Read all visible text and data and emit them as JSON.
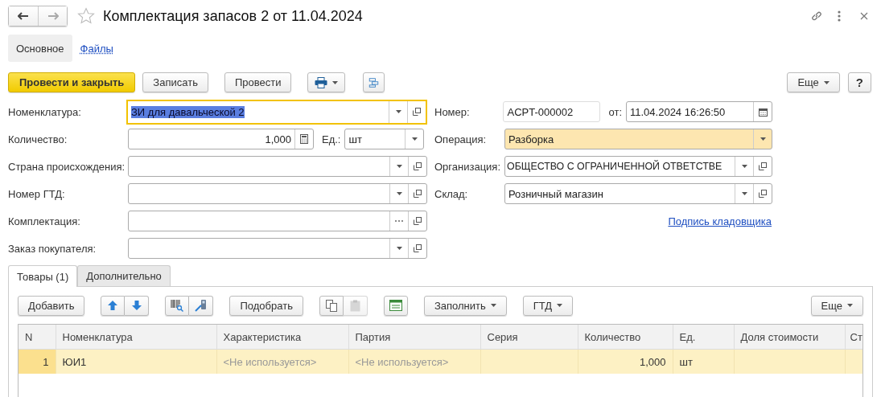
{
  "window": {
    "title": "Комплектация запасов 2 от 11.04.2024",
    "favorite": false
  },
  "sections": [
    {
      "label": "Основное",
      "selected": true
    },
    {
      "label": "Файлы",
      "selected": false
    }
  ],
  "command_bar": {
    "left": [
      {
        "kind": "primary",
        "label": "Провести и закрыть"
      },
      {
        "kind": "plain",
        "label": "Записать"
      },
      {
        "kind": "plain",
        "label": "Провести"
      },
      {
        "kind": "print"
      },
      {
        "kind": "structure"
      }
    ],
    "right": [
      {
        "kind": "menu",
        "label": "Еще"
      },
      {
        "kind": "plain",
        "label": "?"
      }
    ]
  },
  "form_left": [
    {
      "label": "Номенклатура:",
      "value": "ЗИ для давальческой 2",
      "kind": "text",
      "focused": true,
      "buttons": [
        {
          "kind": "dropdown"
        },
        {
          "kind": "open"
        }
      ]
    },
    {
      "label": "Количество:",
      "value": "1,000",
      "kind": "number",
      "focused": false,
      "buttons": [
        {
          "kind": "calculator"
        }
      ],
      "unit": {
        "label": "Ед.:",
        "value": "шт",
        "buttons": [
          {
            "kind": "dropdown"
          }
        ]
      }
    },
    {
      "label": "Страна происхождения:",
      "kind": "text",
      "focused": false,
      "buttons": [
        {
          "kind": "dropdown"
        },
        {
          "kind": "open"
        }
      ]
    },
    {
      "label": "Номер ГТД:",
      "kind": "text",
      "focused": false,
      "buttons": [
        {
          "kind": "dropdown"
        },
        {
          "kind": "open"
        }
      ]
    },
    {
      "label": "Комплектация:",
      "kind": "text",
      "focused": false,
      "buttons": [
        {
          "kind": "ellipsis"
        },
        {
          "kind": "open"
        }
      ]
    },
    {
      "label": "Заказ покупателя:",
      "kind": "text",
      "focused": false,
      "buttons": [
        {
          "kind": "dropdown"
        },
        {
          "kind": "open"
        }
      ]
    }
  ],
  "form_right": [
    {
      "label": "Номер:",
      "value": "ACPT-000002",
      "kind": "input",
      "highlighted": false,
      "date": {
        "label": "от:",
        "value": "11.04.2024 16:26:50",
        "buttons": [
          {
            "kind": "calendar"
          }
        ]
      }
    },
    {
      "label": "Операция:",
      "value": "Разборка",
      "kind": "select",
      "highlighted": true,
      "buttons": [
        {
          "kind": "dropdown"
        }
      ]
    },
    {
      "label": "Организация:",
      "value": "ОБЩЕСТВО С ОГРАНИЧЕННОЙ ОТВЕТСТВЕ",
      "kind": "select",
      "highlighted": false,
      "buttons": [
        {
          "kind": "dropdown"
        },
        {
          "kind": "open"
        }
      ]
    },
    {
      "label": "Склад:",
      "value": "Розничный магазин",
      "kind": "select",
      "highlighted": false,
      "buttons": [
        {
          "kind": "dropdown"
        },
        {
          "kind": "open"
        }
      ]
    }
  ],
  "signature_link": "Подпись кладовщика",
  "tabs": [
    {
      "label": "Товары (1)",
      "selected": true
    },
    {
      "label": "Дополнительно",
      "selected": false
    }
  ],
  "toolbar": {
    "left": [
      {
        "kind": "button",
        "label": "Добавить"
      },
      {
        "kind": "move"
      },
      {
        "kind": "scan"
      },
      {
        "kind": "button",
        "label": "Подобрать"
      },
      {
        "kind": "clipboard"
      },
      {
        "kind": "report"
      },
      {
        "kind": "menu",
        "label": "Заполнить"
      },
      {
        "kind": "menu",
        "label": "ГТД"
      }
    ],
    "right": [
      {
        "kind": "menu",
        "label": "Еще"
      }
    ]
  },
  "table": {
    "columns": [
      {
        "label": "N"
      },
      {
        "label": "Номенклатура"
      },
      {
        "label": "Характеристика"
      },
      {
        "label": "Партия"
      },
      {
        "label": "Серия"
      },
      {
        "label": "Количество"
      },
      {
        "label": "Ед."
      },
      {
        "label": "Доля стоимости"
      },
      {
        "label": "Ст"
      }
    ],
    "rows": [
      {
        "selected": true,
        "cells": [
          {
            "kind": "number",
            "text": "1"
          },
          {
            "kind": "text",
            "text": "ЮИ1"
          },
          {
            "kind": "placeholder",
            "text": "<Не используется>"
          },
          {
            "kind": "placeholder",
            "text": "<Не используется>"
          },
          {
            "kind": "empty"
          },
          {
            "kind": "number",
            "text": "1,000"
          },
          {
            "kind": "text",
            "text": "шт"
          },
          {
            "kind": "empty"
          },
          {
            "kind": "empty"
          }
        ]
      }
    ]
  }
}
